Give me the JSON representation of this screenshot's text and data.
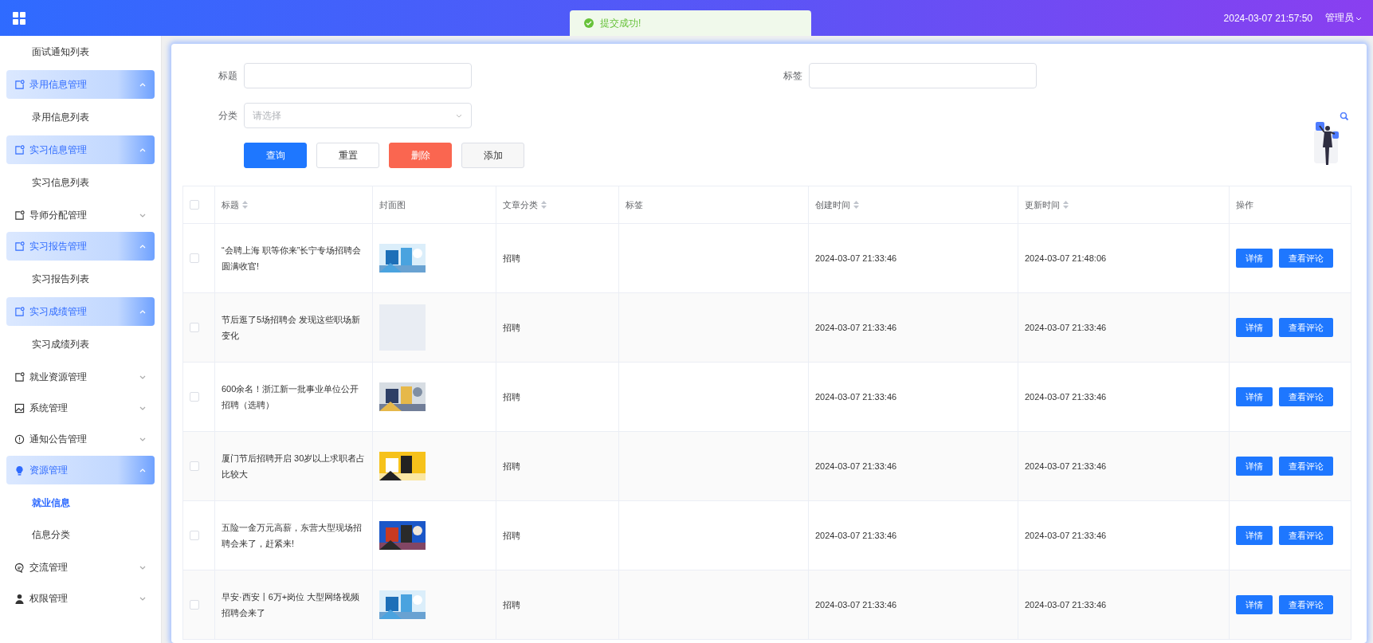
{
  "header": {
    "datetime": "2024-03-07 21:57:50",
    "user": "管理员"
  },
  "toast": {
    "message": "提交成功!"
  },
  "sidebar": {
    "items": [
      {
        "kind": "subitem",
        "label": "面试通知列表",
        "selected": false
      },
      {
        "kind": "group",
        "label": "录用信息管理",
        "expanded": true,
        "children": [
          {
            "kind": "subitem",
            "label": "录用信息列表",
            "selected": false
          }
        ]
      },
      {
        "kind": "group",
        "label": "实习信息管理",
        "expanded": true,
        "children": [
          {
            "kind": "subitem",
            "label": "实习信息列表",
            "selected": false
          }
        ]
      },
      {
        "kind": "group",
        "label": "导师分配管理",
        "expanded": false
      },
      {
        "kind": "group",
        "label": "实习报告管理",
        "expanded": true,
        "children": [
          {
            "kind": "subitem",
            "label": "实习报告列表",
            "selected": false
          }
        ]
      },
      {
        "kind": "group",
        "label": "实习成绩管理",
        "expanded": true,
        "children": [
          {
            "kind": "subitem",
            "label": "实习成绩列表",
            "selected": false
          }
        ]
      },
      {
        "kind": "group",
        "label": "就业资源管理",
        "expanded": false
      },
      {
        "kind": "group",
        "label": "系统管理",
        "expanded": false
      },
      {
        "kind": "group",
        "label": "通知公告管理",
        "expanded": false
      },
      {
        "kind": "group",
        "label": "资源管理",
        "expanded": true,
        "children": [
          {
            "kind": "subitem",
            "label": "就业信息",
            "selected": true
          },
          {
            "kind": "subitem",
            "label": "信息分类",
            "selected": false
          }
        ]
      },
      {
        "kind": "group",
        "label": "交流管理",
        "expanded": false
      },
      {
        "kind": "group",
        "label": "权限管理",
        "expanded": false
      }
    ]
  },
  "filters": {
    "title": {
      "label": "标题"
    },
    "tag": {
      "label": "标签"
    },
    "category": {
      "label": "分类",
      "placeholder": "请选择"
    }
  },
  "buttons": [
    {
      "label": "查询",
      "kind": "primary"
    },
    {
      "label": "重置",
      "kind": "default"
    },
    {
      "label": "删除",
      "kind": "danger"
    },
    {
      "label": "添加",
      "kind": "hover"
    }
  ],
  "table": {
    "header_checked": false,
    "columns": [
      {
        "label": "标题",
        "sortable": true
      },
      {
        "label": "封面图",
        "sortable": false
      },
      {
        "label": "文章分类",
        "sortable": true
      },
      {
        "label": "标签",
        "sortable": false
      },
      {
        "label": "创建时间",
        "sortable": true
      },
      {
        "label": "更新时间",
        "sortable": true
      },
      {
        "label": "操作",
        "sortable": false
      }
    ],
    "rows": [
      {
        "checked": false,
        "title": "“会聘上海 职等你来”长宁专场招聘会圆满收官!",
        "category": "招聘",
        "created": "2024-03-07 21:33:46",
        "updated": "2024-03-07 21:48:06",
        "actions": [
          "详情",
          "查看评论"
        ]
      },
      {
        "checked": false,
        "title": "节后逛了5场招聘会 发现这些职场新变化",
        "cover": {
          "kind": "empty"
        },
        "category": "招聘",
        "created": "2024-03-07 21:33:46",
        "updated": "2024-03-07 21:33:46",
        "actions": [
          "详情",
          "查看评论"
        ]
      },
      {
        "checked": false,
        "title": "600余名！浙江新一批事业单位公开招聘（选聘）",
        "category": "招聘",
        "created": "2024-03-07 21:33:46",
        "updated": "2024-03-07 21:33:46",
        "actions": [
          "详情",
          "查看评论"
        ]
      },
      {
        "checked": false,
        "title": "厦门节后招聘开启 30岁以上求职者占比较大",
        "category": "招聘",
        "created": "2024-03-07 21:33:46",
        "updated": "2024-03-07 21:33:46",
        "actions": [
          "详情",
          "查看评论"
        ]
      },
      {
        "checked": false,
        "title": "五险一金万元高薪，东营大型现场招聘会来了，赶紧来!",
        "category": "招聘",
        "created": "2024-03-07 21:33:46",
        "updated": "2024-03-07 21:33:46",
        "actions": [
          "详情",
          "查看评论"
        ]
      },
      {
        "checked": false,
        "title": "早安·西安丨6万+岗位 大型网络视频招聘会来了",
        "category": "招聘",
        "created": "2024-03-07 21:33:46",
        "updated": "2024-03-07 21:33:46",
        "actions": [
          "详情",
          "查看评论"
        ]
      }
    ]
  }
}
